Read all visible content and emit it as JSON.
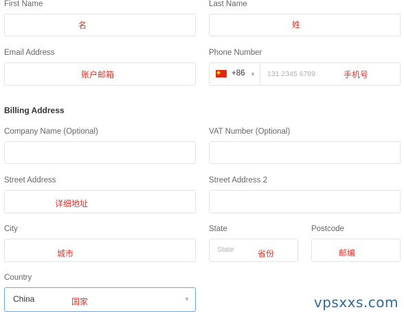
{
  "fields": {
    "first_name": {
      "label": "First Name",
      "annotation": "名"
    },
    "last_name": {
      "label": "Last Name",
      "annotation": "姓"
    },
    "email": {
      "label": "Email Address",
      "annotation": "账户邮箱"
    },
    "phone": {
      "label": "Phone Number",
      "country_code": "+86",
      "placeholder": "131 2345 6789",
      "annotation": "手机号"
    },
    "company": {
      "label": "Company Name (Optional)"
    },
    "vat": {
      "label": "VAT Number (Optional)"
    },
    "street": {
      "label": "Street Address",
      "annotation": "详细地址"
    },
    "street2": {
      "label": "Street Address 2"
    },
    "city": {
      "label": "City",
      "annotation": "城市"
    },
    "state": {
      "label": "State",
      "placeholder": "State",
      "annotation": "省份"
    },
    "postcode": {
      "label": "Postcode",
      "annotation": "邮编"
    },
    "country": {
      "label": "Country",
      "value": "China",
      "annotation": "国家"
    }
  },
  "billing_heading": "Billing Address",
  "watermark": "vpsxxs.com",
  "colors": {
    "annotation": "#e0342c",
    "focus_border": "#6aa9e9",
    "flag": "#de2910"
  }
}
